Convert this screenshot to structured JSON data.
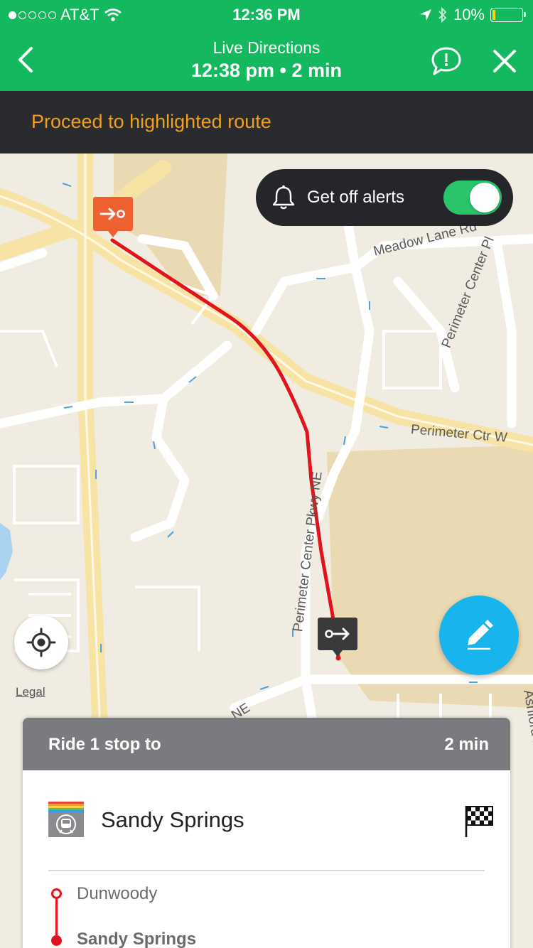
{
  "status_bar": {
    "carrier": "AT&T",
    "time": "12:36 PM",
    "battery": "10%",
    "battery_level": 0.1,
    "signal_bars": 1,
    "signal_total": 5
  },
  "nav": {
    "title": "Live Directions",
    "subtitle": "12:38 pm • 2 min",
    "back_icon": "chevron-left-icon",
    "report_icon": "report-bubble-icon",
    "close_icon": "close-icon"
  },
  "banner": {
    "text": "Proceed to highlighted route"
  },
  "map": {
    "alerts_label": "Get off alerts",
    "alerts_enabled": true,
    "legal": "Legal",
    "road_labels": {
      "meadow": "Meadow Lane Rd",
      "pc_place": "Perimeter Center Pl",
      "pc_west": "Perimeter Ctr W",
      "pc_pkwy": "Perimeter Center Pkwy NE",
      "ne": "NE",
      "ashford": "Ashford Dunwo"
    },
    "colors": {
      "route": "#e0141e",
      "board_marker": "#ee6030",
      "alight_marker": "#3a3a3d"
    }
  },
  "card": {
    "title": "Ride 1 stop to",
    "eta": "2 min",
    "destination": "Sandy Springs",
    "stops": [
      "Dunwoody",
      "Sandy Springs"
    ]
  },
  "colors": {
    "brand_green": "#14b85f",
    "banner_text": "#f0a020",
    "fab_blue": "#18b4ee"
  }
}
